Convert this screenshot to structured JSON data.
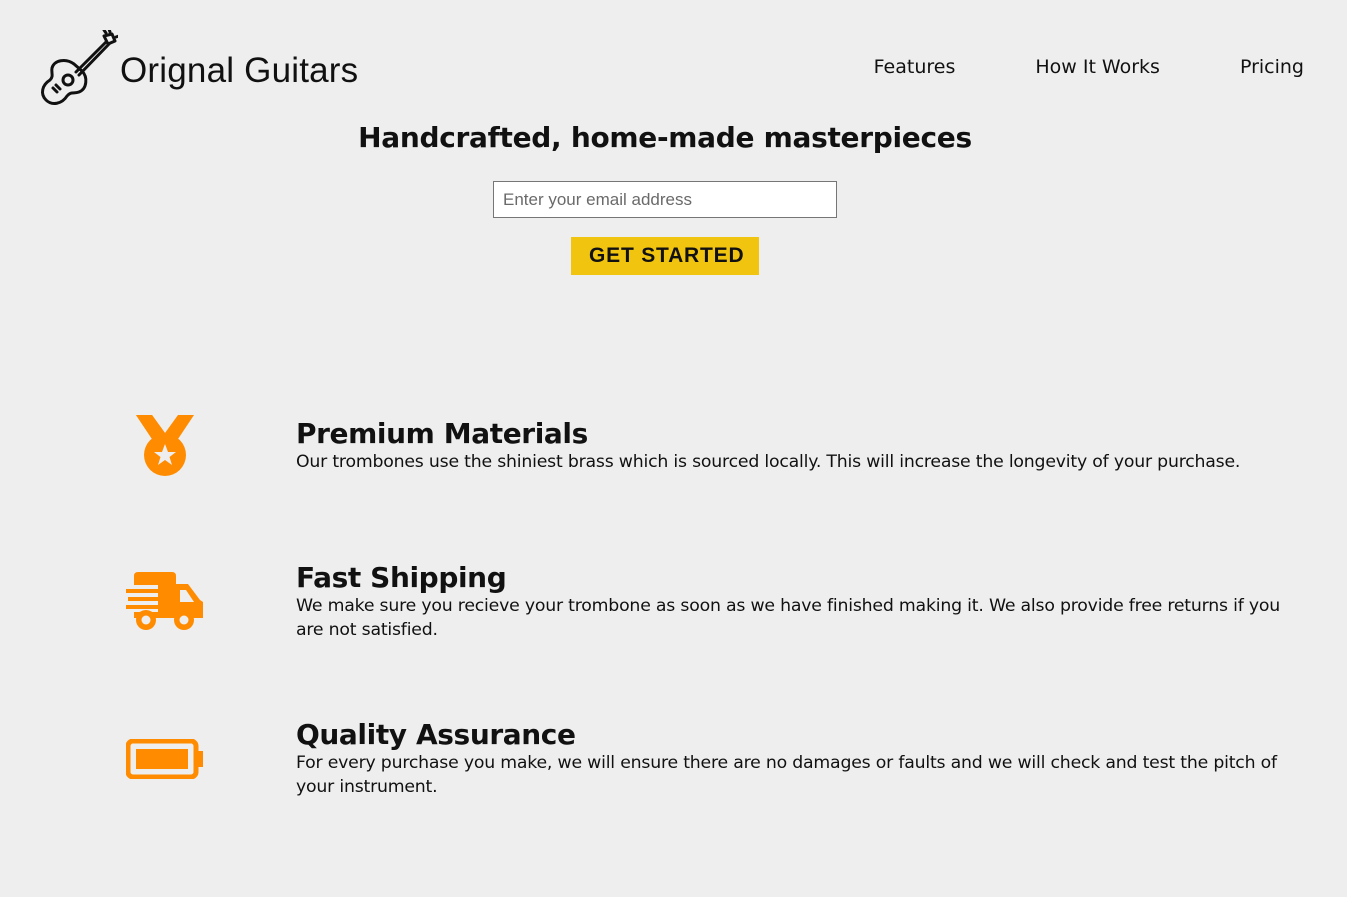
{
  "brand": {
    "name": "Orignal Guitars",
    "logo_icon": "guitar-icon"
  },
  "nav": {
    "items": [
      {
        "label": "Features"
      },
      {
        "label": "How It Works"
      },
      {
        "label": "Pricing"
      }
    ]
  },
  "hero": {
    "title": "Handcrafted, home-made masterpieces",
    "email_placeholder": "Enter your email address",
    "email_value": "",
    "cta_label": "GET STARTED"
  },
  "features": [
    {
      "icon": "medal-icon",
      "title": "Premium Materials",
      "description": "Our trombones use the shiniest brass which is sourced locally. This will increase the longevity of your purchase."
    },
    {
      "icon": "truck-icon",
      "title": "Fast Shipping",
      "description": "We make sure you recieve your trombone as soon as we have finished making it. We also provide free returns if you are not satisfied."
    },
    {
      "icon": "battery-icon",
      "title": "Quality Assurance",
      "description": "For every purchase you make, we will ensure there are no damages or faults and we will check and test the pitch of your instrument."
    }
  ],
  "colors": {
    "background": "#eeeeee",
    "accent_button": "#f1c40f",
    "icon_orange": "#ff8c00",
    "text": "#111111"
  }
}
